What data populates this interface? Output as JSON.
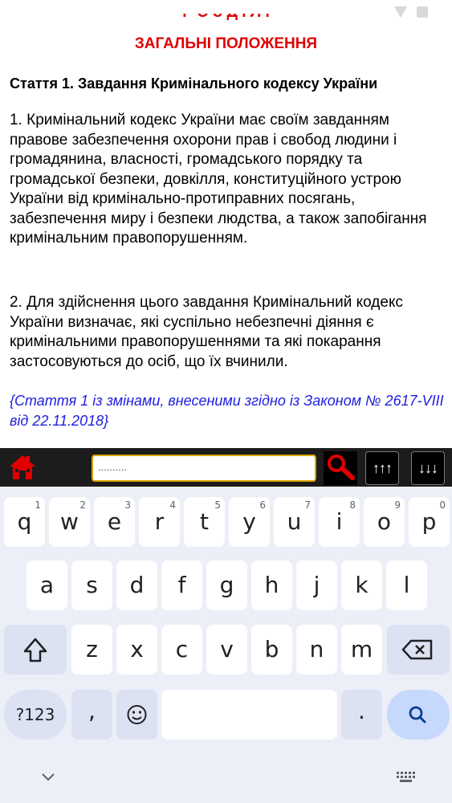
{
  "article": {
    "chapter_cut": "Р О З Д І Л  I",
    "chapter_title": "ЗАГАЛЬНІ ПОЛОЖЕННЯ",
    "heading": "Стаття 1. Завдання Кримінального кодексу України",
    "paragraph1": "1. Кримінальний кодекс України має своїм завданням правове забезпечення охорони прав і свобод людини і громадянина, власності, громадського порядку та громадської безпеки, довкілля, конституційного устрою України від кримінально-протиправних посягань, забезпечення миру і безпеки людства, а також запобігання кримінальним правопорушенням.",
    "paragraph2": "2. Для здійснення цього завдання Кримінальний кодекс України визначає, які суспільно небезпечні діяння є кримінальними правопорушеннями та які покарання застосовуються до осіб, що їх вчинили.",
    "amendment": "{Стаття 1 із змінами, внесеними згідно із Законом № 2617-VIII від 22.11.2018}"
  },
  "toolbar": {
    "search_value": "..........",
    "up_label": "↑↑↑",
    "down_label": "↓↓↓",
    "colors": {
      "background": "#1c1c1c",
      "accent": "#e00000",
      "input_border": "#d6a400"
    }
  },
  "keyboard": {
    "row1": [
      {
        "key": "q",
        "hint": "1"
      },
      {
        "key": "w",
        "hint": "2"
      },
      {
        "key": "e",
        "hint": "3"
      },
      {
        "key": "r",
        "hint": "4"
      },
      {
        "key": "t",
        "hint": "5"
      },
      {
        "key": "y",
        "hint": "6"
      },
      {
        "key": "u",
        "hint": "7"
      },
      {
        "key": "i",
        "hint": "8"
      },
      {
        "key": "o",
        "hint": "9"
      },
      {
        "key": "p",
        "hint": "0"
      }
    ],
    "row2": [
      "a",
      "s",
      "d",
      "f",
      "g",
      "h",
      "j",
      "k",
      "l"
    ],
    "row3": [
      "z",
      "x",
      "c",
      "v",
      "b",
      "n",
      "m"
    ],
    "numbers_label": "?123",
    "comma": ",",
    "period": ".",
    "icons": [
      "shift-icon",
      "backspace-icon",
      "emoji-icon",
      "search-icon",
      "chevron-down-icon",
      "keyboard-icon"
    ]
  }
}
